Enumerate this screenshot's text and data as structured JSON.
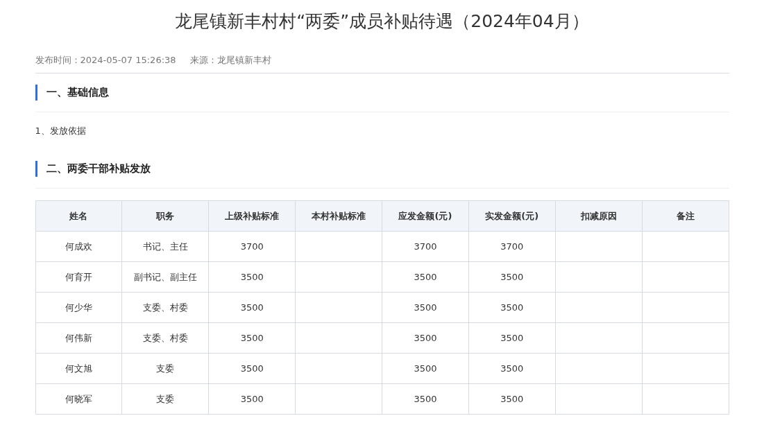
{
  "article": {
    "title": "龙尾镇新丰村村“两委”成员补贴待遇（2024年04月）",
    "publish_time": "发布时间：2024-05-07 15:26:38",
    "source": "来源：龙尾镇新丰村"
  },
  "sections": [
    {
      "heading": "一、基础信息",
      "paragraphs": [
        "1、发放依据"
      ]
    },
    {
      "heading": "二、两委干部补贴发放"
    }
  ],
  "table": {
    "columns": [
      "姓名",
      "职务",
      "上级补贴标准",
      "本村补贴标准",
      "应发金额(元)",
      "实发金额(元)",
      "扣减原因",
      "备注"
    ],
    "rows": [
      {
        "name": "何成欢",
        "position": "书记、主任",
        "upper_standard": "3700",
        "amount_due": "3700",
        "amount_paid": "3700"
      },
      {
        "name": "何育开",
        "position": "副书记、副主任",
        "upper_standard": "3500",
        "amount_due": "3500",
        "amount_paid": "3500"
      },
      {
        "name": "何少华",
        "position": "支委、村委",
        "upper_standard": "3500",
        "amount_due": "3500",
        "amount_paid": "3500"
      },
      {
        "name": "何伟新",
        "position": "支委、村委",
        "upper_standard": "3500",
        "amount_due": "3500",
        "amount_paid": "3500"
      },
      {
        "name": "何文旭",
        "position": "支委",
        "upper_standard": "3500",
        "amount_due": "3500",
        "amount_paid": "3500"
      },
      {
        "name": "何晓军",
        "position": "支委",
        "upper_standard": "3500",
        "amount_due": "3500",
        "amount_paid": "3500"
      }
    ]
  }
}
